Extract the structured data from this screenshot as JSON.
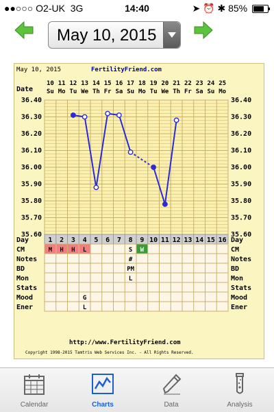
{
  "status_bar": {
    "carrier": "●●○○○ O2-UK",
    "network": "3G",
    "time": "14:40",
    "battery_text": "85%",
    "battery_level": 0.85
  },
  "date_selector": {
    "value": "May 10, 2015"
  },
  "chart_header": {
    "date": "May 10, 2015",
    "site": "FertilityFriend.com"
  },
  "chart_footer": {
    "url": "http://www.FertilityFriend.com",
    "copyright": "Copyright 1998-2015 Tamtris Web Services Inc. - All Rights Reserved."
  },
  "tabs": [
    {
      "label": "Calendar",
      "icon": "calendar-icon",
      "active": false
    },
    {
      "label": "Charts",
      "icon": "chart-icon",
      "active": true
    },
    {
      "label": "Data",
      "icon": "pencil-icon",
      "active": false
    },
    {
      "label": "Analysis",
      "icon": "test-tube-icon",
      "active": false
    }
  ],
  "colors": {
    "series": "#2a2ad8",
    "grid": "#c9b26a",
    "cm_m": "#f08080",
    "cm_w": "#3c9a3c",
    "accent": "#1a5fd2",
    "arrow_green": "#5cc43c"
  },
  "chart_data": {
    "type": "line",
    "dates": [
      "10",
      "11",
      "12",
      "13",
      "14",
      "15",
      "16",
      "17",
      "18",
      "19",
      "20",
      "21",
      "22",
      "23",
      "24",
      "25"
    ],
    "weekdays": [
      "Su",
      "Mo",
      "Tu",
      "We",
      "Th",
      "Fr",
      "Sa",
      "Su",
      "Mo",
      "Tu",
      "We",
      "Th",
      "Fr",
      "Sa",
      "Su",
      "Mo"
    ],
    "days": [
      "1",
      "2",
      "3",
      "4",
      "5",
      "6",
      "7",
      "8",
      "9",
      "10",
      "11",
      "12",
      "13",
      "14",
      "15",
      "16"
    ],
    "y_ticks": [
      "36.40",
      "36.30",
      "36.20",
      "36.10",
      "36.00",
      "35.90",
      "35.80",
      "35.70",
      "35.60"
    ],
    "ylim": [
      35.6,
      36.4
    ],
    "row_labels": {
      "date": "Date",
      "day": "Day"
    },
    "temps": [
      {
        "day": 3,
        "value": 36.31,
        "style": "filled"
      },
      {
        "day": 4,
        "value": 36.3,
        "style": "open"
      },
      {
        "day": 5,
        "value": 35.88,
        "style": "open"
      },
      {
        "day": 6,
        "value": 36.32,
        "style": "open"
      },
      {
        "day": 7,
        "value": 36.31,
        "style": "open"
      },
      {
        "day": 8,
        "value": 36.09,
        "style": "open"
      },
      {
        "day": 10,
        "value": 36.0,
        "style": "filled"
      },
      {
        "day": 11,
        "value": 35.78,
        "style": "filled"
      },
      {
        "day": 12,
        "value": 36.28,
        "style": "open"
      }
    ],
    "segments": [
      {
        "from": 3,
        "to": 4,
        "dashed": false
      },
      {
        "from": 4,
        "to": 5,
        "dashed": false
      },
      {
        "from": 5,
        "to": 6,
        "dashed": false
      },
      {
        "from": 6,
        "to": 7,
        "dashed": false
      },
      {
        "from": 7,
        "to": 8,
        "dashed": false
      },
      {
        "from": 8,
        "to": 10,
        "dashed": true
      },
      {
        "from": 10,
        "to": 11,
        "dashed": false
      },
      {
        "from": 11,
        "to": 12,
        "dashed": false
      }
    ],
    "rows": [
      {
        "label": "CM",
        "cells": [
          {
            "day": 1,
            "text": "M",
            "fill": "m"
          },
          {
            "day": 2,
            "text": "H",
            "fill": "m"
          },
          {
            "day": 3,
            "text": "H",
            "fill": "m"
          },
          {
            "day": 4,
            "text": "L",
            "fill": "m"
          },
          {
            "day": 8,
            "text": "S"
          },
          {
            "day": 9,
            "text": "W",
            "fill": "w"
          }
        ]
      },
      {
        "label": "Notes",
        "cells": [
          {
            "day": 8,
            "text": "#"
          }
        ]
      },
      {
        "label": "BD",
        "cells": [
          {
            "day": 8,
            "text": "PM"
          }
        ]
      },
      {
        "label": "Mon",
        "cells": [
          {
            "day": 8,
            "text": "L"
          }
        ]
      },
      {
        "label": "Stats",
        "cells": []
      },
      {
        "label": "Mood",
        "cells": [
          {
            "day": 4,
            "text": "G"
          }
        ]
      },
      {
        "label": "Ener",
        "cells": [
          {
            "day": 4,
            "text": "L"
          }
        ]
      }
    ]
  }
}
